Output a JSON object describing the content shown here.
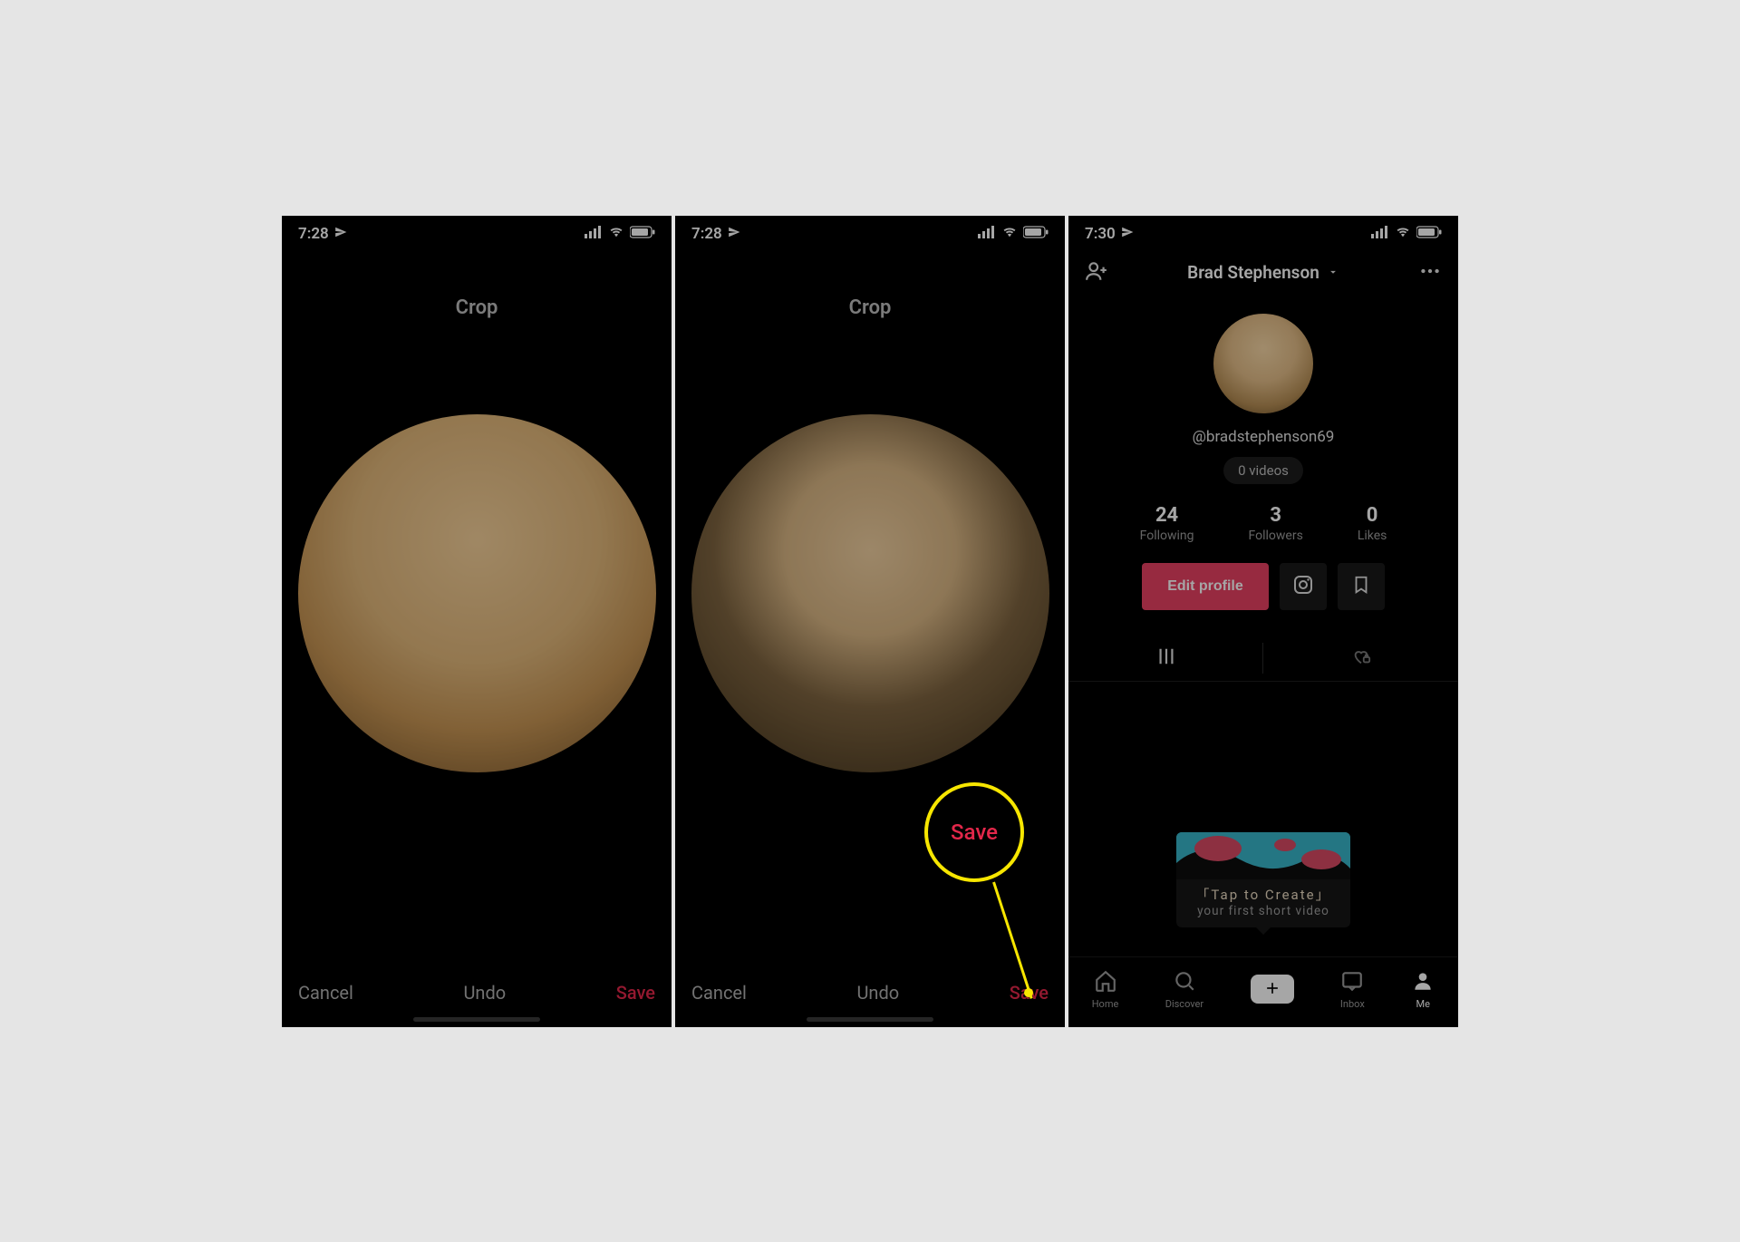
{
  "screen1": {
    "time": "7:28",
    "title": "Crop",
    "cancel": "Cancel",
    "undo": "Undo",
    "save": "Save"
  },
  "screen2": {
    "time": "7:28",
    "title": "Crop",
    "cancel": "Cancel",
    "undo": "Undo",
    "save": "Save",
    "callout_label": "Save"
  },
  "screen3": {
    "time": "7:30",
    "display_name": "Brad Stephenson",
    "username": "@bradstephenson69",
    "video_count_label": "0 videos",
    "stats": {
      "following": {
        "count": "24",
        "label": "Following"
      },
      "followers": {
        "count": "3",
        "label": "Followers"
      },
      "likes": {
        "count": "0",
        "label": "Likes"
      }
    },
    "edit_profile": "Edit profile",
    "tap_create_title": "「Tap to Create」",
    "tap_create_sub": "your first short video",
    "nav": {
      "home": "Home",
      "discover": "Discover",
      "inbox": "Inbox",
      "me": "Me"
    }
  }
}
